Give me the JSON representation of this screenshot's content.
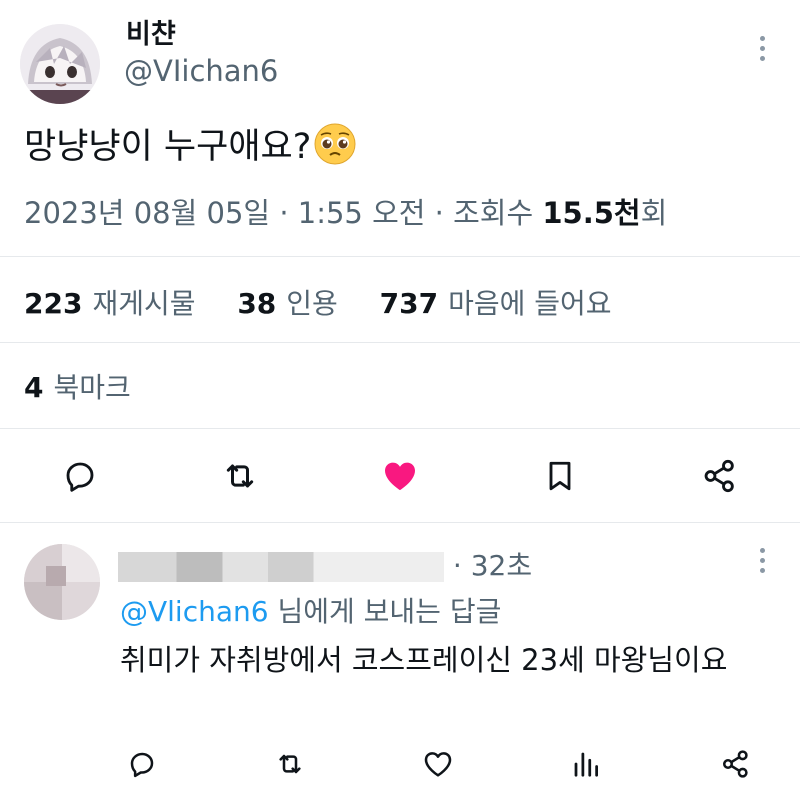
{
  "tweet": {
    "author_name": "비챤",
    "author_handle": "@VIichan6",
    "text": "망냥냥이 누구애요?",
    "emoji": "🥺",
    "date": "2023년 08월 05일",
    "time": "1:55 오전",
    "views_label": "조회수",
    "views_value": "15.5천",
    "views_suffix": "회",
    "retweets": "223",
    "retweets_label": "재게시물",
    "quotes": "38",
    "quotes_label": "인용",
    "likes": "737",
    "likes_label": "마음에 들어요",
    "bookmarks": "4",
    "bookmarks_label": "북마크",
    "liked": true
  },
  "reply": {
    "age": "32초",
    "reply_to_handle": "@Vlichan6",
    "reply_to_suffix": "님에게 보내는 답글",
    "text": "취미가 자취방에서 코스프레이신 23세 마왕님이요"
  },
  "colors": {
    "like": "#f91880",
    "mention": "#1d9bf0",
    "secondary_text": "#536471"
  },
  "icons": [
    "reply-icon",
    "retweet-icon",
    "heart-icon",
    "bookmark-icon",
    "share-icon",
    "views-icon",
    "more-icon"
  ]
}
